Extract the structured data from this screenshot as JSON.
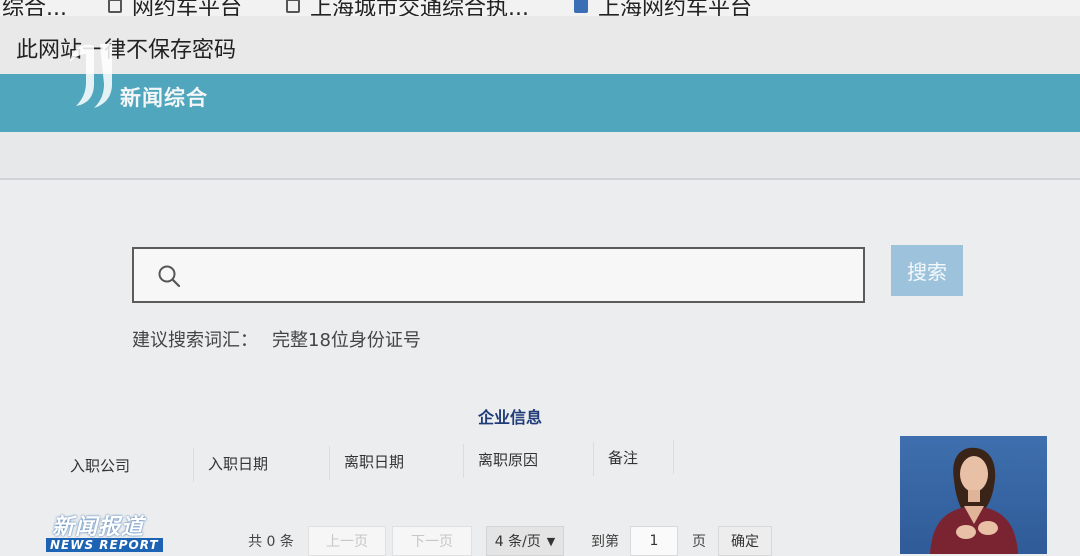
{
  "bookmarks": [
    {
      "label": "综合..."
    },
    {
      "label": "网约车平台"
    },
    {
      "label": "上海城市交通综合执..."
    },
    {
      "label": "上海网约车平台"
    }
  ],
  "notice": {
    "text": "此网站一律不保存密码"
  },
  "channel": {
    "caption": "新闻综合"
  },
  "search": {
    "value": "",
    "placeholder": "",
    "button_label": "搜索",
    "hint_label": "建议搜索词汇：",
    "hint_value": "完整18位身份证号"
  },
  "enterprise": {
    "title": "企业信息",
    "columns": [
      "入职公司",
      "入职日期",
      "离职日期",
      "离职原因",
      "备注"
    ]
  },
  "pagination": {
    "total": "共 0 条",
    "prev": "上一页",
    "next": "下一页",
    "per_page": "4 条/页",
    "goto_label": "到第",
    "page_value": "1",
    "page_suffix": "页",
    "confirm": "确定"
  },
  "program": {
    "cn": "新闻报道",
    "en": "NEWS REPORT"
  },
  "colors": {
    "header": "#4fa6bd",
    "search_button": "#9dc3dc",
    "title": "#1f3b78"
  }
}
